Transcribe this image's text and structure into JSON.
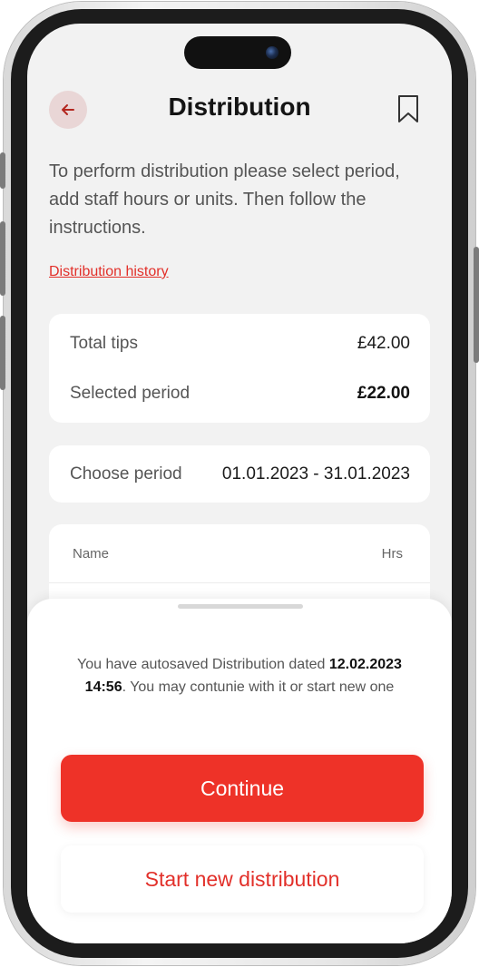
{
  "header": {
    "title": "Distribution"
  },
  "intro": {
    "text": "To perform distribution please select period, add staff hours or units. Then follow the instructions."
  },
  "links": {
    "history": "Distribution history"
  },
  "summary": {
    "total_tips_label": "Total tips",
    "total_tips_value": "£42.00",
    "selected_period_label": "Selected period",
    "selected_period_value": "£22.00"
  },
  "period": {
    "label": "Choose period",
    "value": "01.01.2023 - 31.01.2023"
  },
  "table": {
    "columns": [
      "Name",
      "Hrs"
    ]
  },
  "sheet": {
    "message_prefix": "You have autosaved Distribution dated ",
    "message_date": "12.02.2023 14:56",
    "message_suffix": ". You may contunie with it or start new one",
    "continue_label": "Continue",
    "new_label": "Start new distribution"
  },
  "icons": {
    "back": "arrow-left-icon",
    "bookmark": "bookmark-icon"
  },
  "colors": {
    "accent": "#ee3228",
    "link": "#e2302a",
    "background": "#f2f2f2"
  }
}
